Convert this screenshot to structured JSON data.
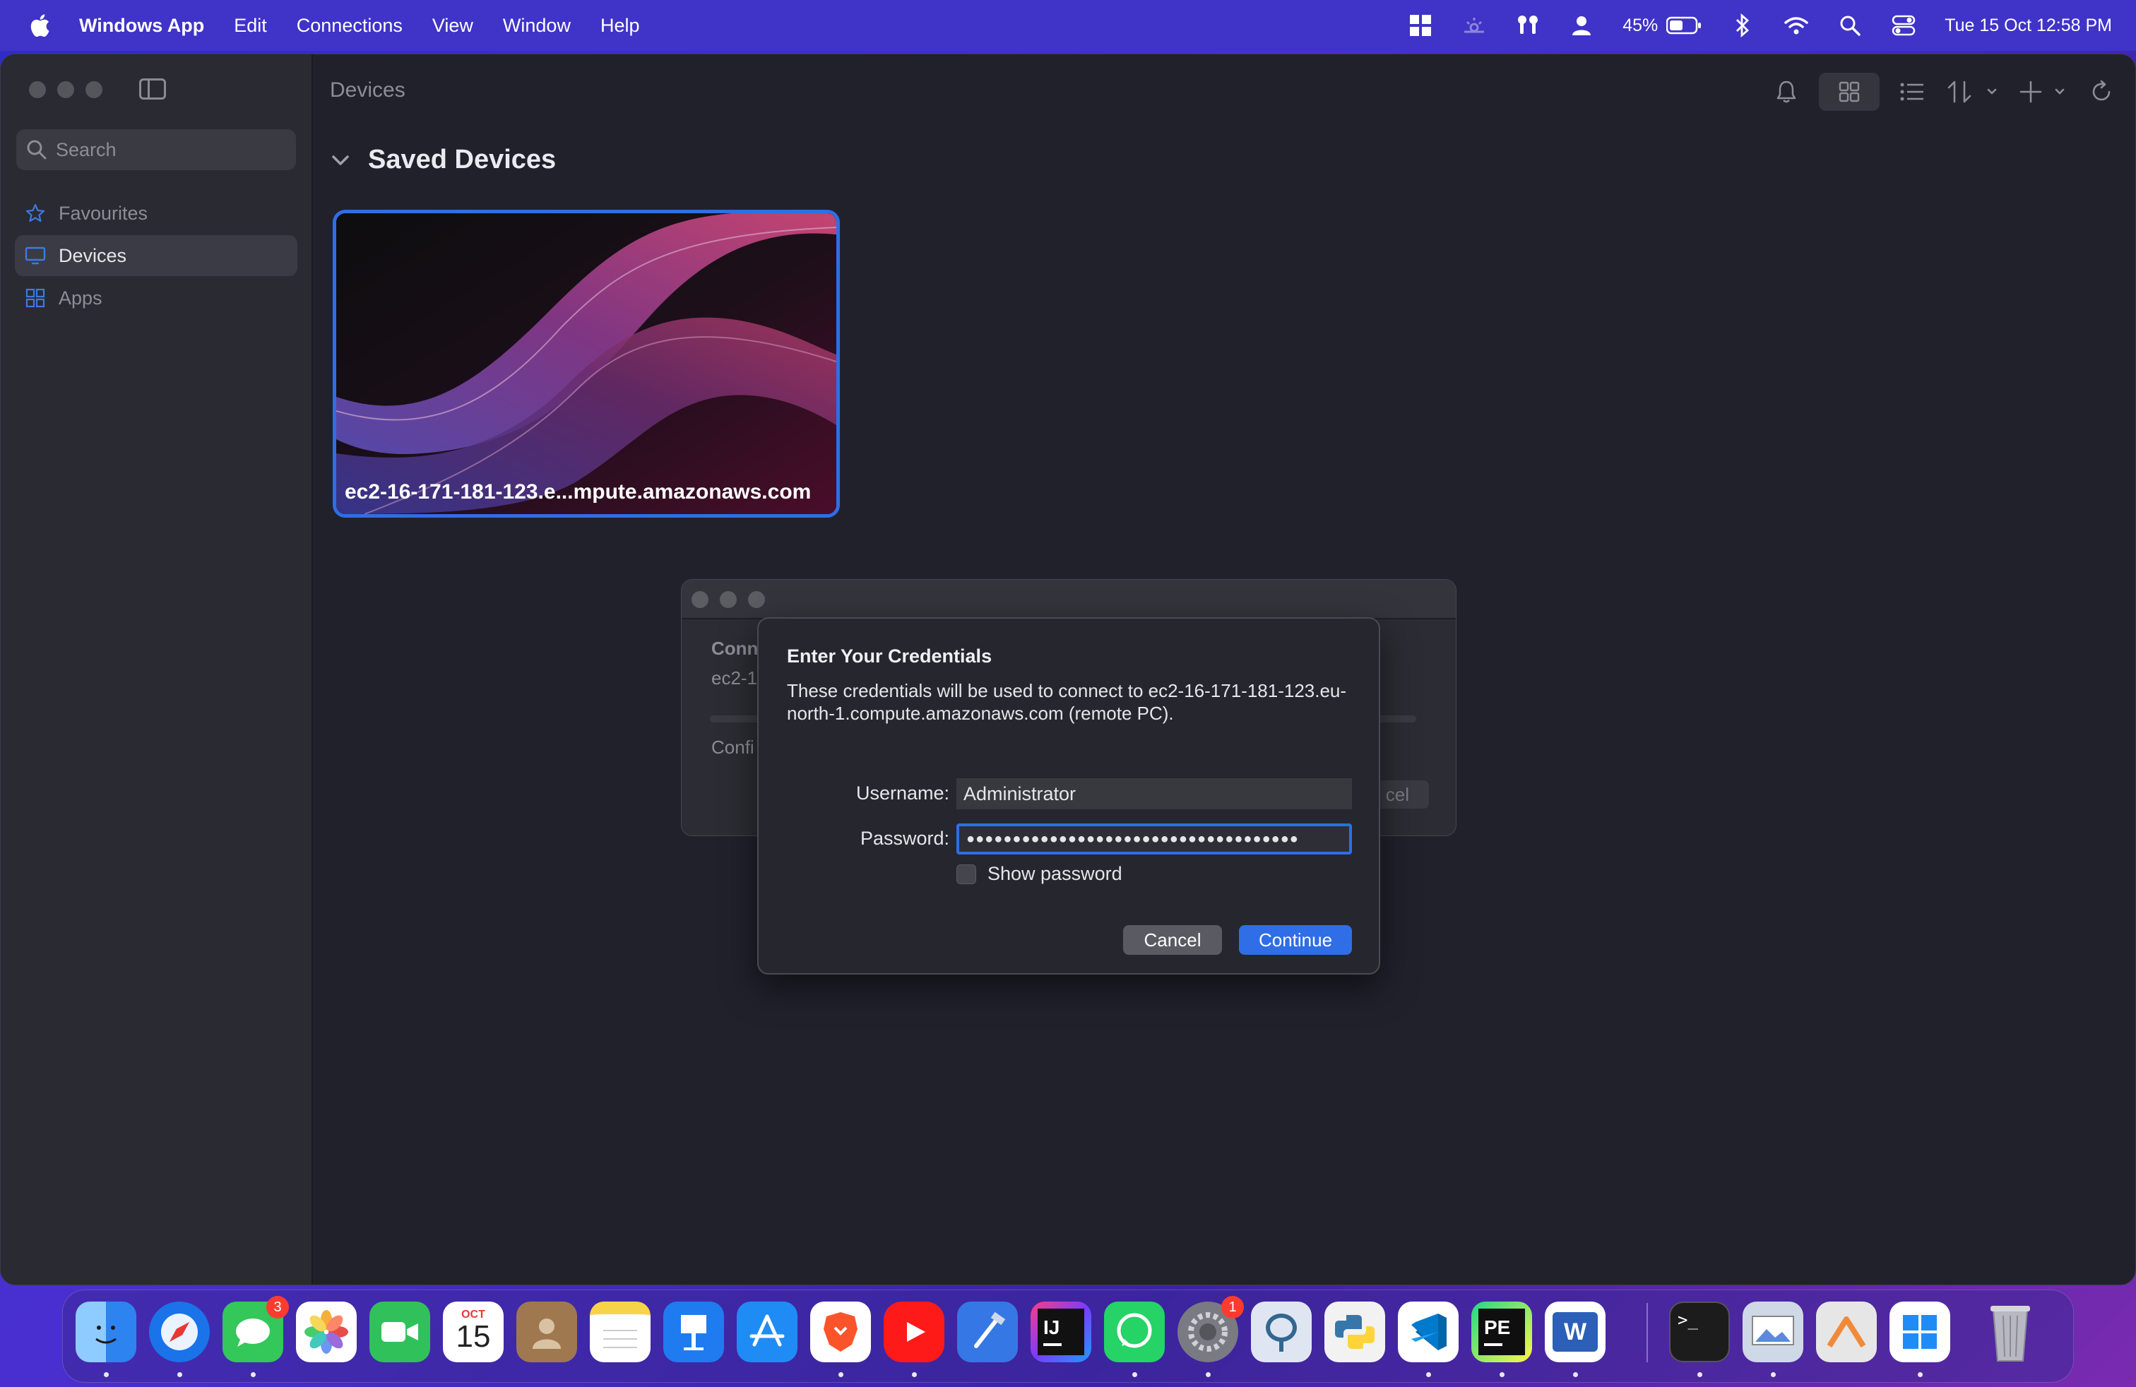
{
  "menubar": {
    "app_name": "Windows App",
    "menus": [
      "Edit",
      "Connections",
      "View",
      "Window",
      "Help"
    ],
    "battery": "45%",
    "datetime": "Tue 15 Oct  12:58 PM"
  },
  "sidebar": {
    "search_placeholder": "Search",
    "items": [
      {
        "label": "Favourites",
        "icon": "star-icon"
      },
      {
        "label": "Devices",
        "icon": "monitor-icon",
        "selected": true
      },
      {
        "label": "Apps",
        "icon": "apps-grid-icon"
      }
    ]
  },
  "main": {
    "title": "Devices",
    "section_title": "Saved Devices",
    "device_card": {
      "name": "ec2-16-171-181-123.e...mpute.amazonaws.com"
    }
  },
  "bg_dialog": {
    "line1": "Conn",
    "line2": "ec2-1",
    "line3": "Confi",
    "button": "cel"
  },
  "credentials_dialog": {
    "title": "Enter Your Credentials",
    "message": "These credentials will be used to connect to ec2-16-171-181-123.eu-north-1.compute.amazonaws.com (remote PC).",
    "username_label": "Username:",
    "username_value": "Administrator",
    "password_label": "Password:",
    "password_value": "●●●●●●●●●●●●●●●●●●●●●●●●●●●●●●●●●●●●",
    "show_password_label": "Show password",
    "show_password_checked": false,
    "cancel_label": "Cancel",
    "continue_label": "Continue"
  },
  "dock": {
    "apps": [
      {
        "name": "Finder",
        "color": "#3b8cf0"
      },
      {
        "name": "Safari",
        "color": "#1a73e8"
      },
      {
        "name": "Messages",
        "color": "#34c759",
        "badge": "3"
      },
      {
        "name": "Photos",
        "color": "#ffffff"
      },
      {
        "name": "FaceTime",
        "color": "#30c15a"
      },
      {
        "name": "Calendar",
        "color": "#ffffff",
        "month": "OCT",
        "day": "15"
      },
      {
        "name": "Contacts",
        "color": "#a07850"
      },
      {
        "name": "Notes",
        "color": "#f7d34a"
      },
      {
        "name": "Keynote",
        "color": "#1e7cf0"
      },
      {
        "name": "App Store",
        "color": "#1f8cf5"
      },
      {
        "name": "Brave",
        "color": "#ffffff"
      },
      {
        "name": "YouTube",
        "color": "#ff1a1a"
      },
      {
        "name": "Xcode",
        "color": "#3578e5"
      },
      {
        "name": "IntelliJ IDEA",
        "color": "#1b1b2b",
        "label": "IJ"
      },
      {
        "name": "WhatsApp",
        "color": "#25d366"
      },
      {
        "name": "System Settings",
        "color": "#7a7a82",
        "badge": "1"
      },
      {
        "name": "pgAdmin",
        "color": "#dfe6f2"
      },
      {
        "name": "Python Launcher",
        "color": "#f2f2f2"
      },
      {
        "name": "VS Code",
        "color": "#ffffff"
      },
      {
        "name": "PyCharm",
        "color": "#0f0f0f",
        "label": "PE"
      },
      {
        "name": "Word",
        "color": "#2b5fb8",
        "label": "W"
      },
      {
        "name": "Terminal",
        "color": "#1c1c1c",
        "label": ">_"
      },
      {
        "name": "Preview",
        "color": "#cfd8e6"
      },
      {
        "name": "Sublime",
        "color": "#e6e6e6"
      },
      {
        "name": "Windows App",
        "color": "#ffffff"
      },
      {
        "name": "Trash",
        "color": "#8a8a95"
      }
    ]
  },
  "colors": {
    "accent": "#2f6ee6",
    "menubar": "#4033c7",
    "window_bg": "#21212c",
    "sidebar_bg": "#2a2a33"
  }
}
